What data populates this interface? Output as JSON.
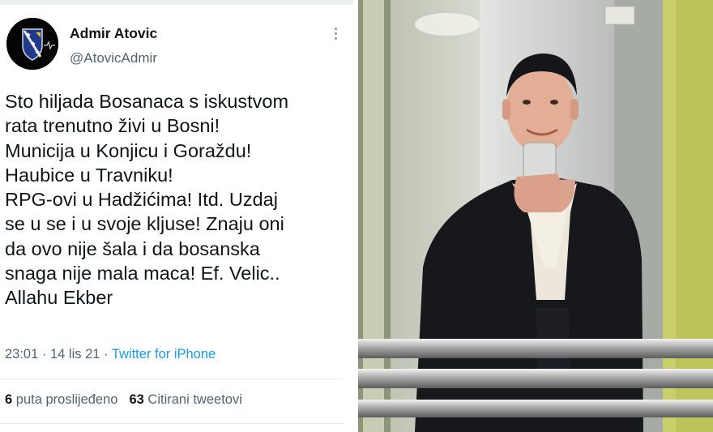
{
  "tweet": {
    "author_name": "Admir Atovic",
    "author_handle": "@AtovicAdmir",
    "more_icon": "vertical-ellipsis",
    "avatar_icon": "bosnian-coat-of-arms",
    "lines": [
      "Sto hiljada Bosanaca s iskustvom",
      "rata trenutno živi u Bosni!",
      "Municija u Konjicu i Goraždu!",
      "Haubice u Travniku!",
      "RPG-ovi u Hadžićima! Itd. Uzdaj",
      "se u se i u svoje kljuse! Znaju oni",
      "da ovo nije šala i da bosanska",
      "snaga nije mala maca! Ef. Velic..",
      "Allahu Ekber"
    ],
    "time": "23:01",
    "date": "14 lis 21",
    "separator": " · ",
    "source": "Twitter for iPhone",
    "retweets_count": "6",
    "retweets_label": "puta proslijeđeno",
    "quotes_count": "63",
    "quotes_label": "Citirani tweetovi"
  },
  "colors": {
    "text_primary": "#0f1419",
    "text_secondary": "#536471",
    "link": "#1d9bf0",
    "divider": "#e6e9ec"
  },
  "photo": {
    "subject": "man-taking-mirror-selfie-in-elevator"
  }
}
